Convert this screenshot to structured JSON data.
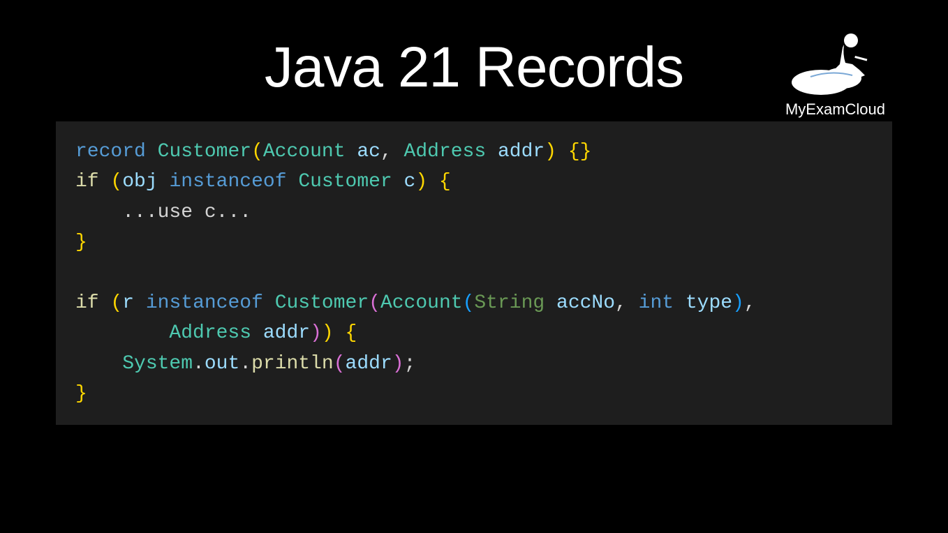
{
  "title": "Java 21 Records",
  "brand": "MyExamCloud",
  "code": {
    "line1": {
      "kw_record": "record",
      "type_customer": "Customer",
      "type_account": "Account",
      "var_ac": "ac",
      "type_address": "Address",
      "var_addr": "addr"
    },
    "line2": {
      "kw_if": "if",
      "var_obj": "obj",
      "kw_instanceof": "instanceof",
      "type_customer": "Customer",
      "var_c": "c"
    },
    "line3": {
      "comment": "...use c..."
    },
    "line4": {
      "brace": "}"
    },
    "line5": {
      "kw_if": "if",
      "var_r": "r",
      "kw_instanceof": "instanceof",
      "type_customer": "Customer",
      "type_account": "Account",
      "type_string": "String",
      "var_accno": "accNo",
      "kw_int": "int",
      "var_type": "type"
    },
    "line6": {
      "type_address": "Address",
      "var_addr": "addr"
    },
    "line7": {
      "sys": "System",
      "out": "out",
      "println": "println",
      "arg": "addr"
    },
    "line8": {
      "brace": "}"
    }
  }
}
